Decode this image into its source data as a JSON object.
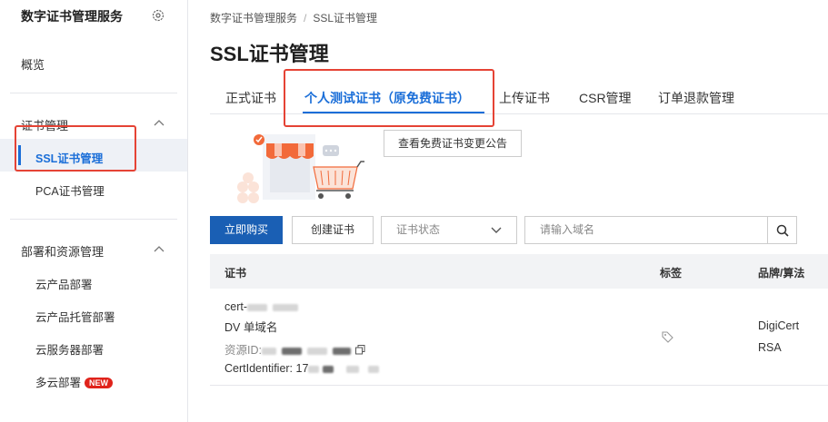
{
  "sidebar": {
    "title": "数字证书管理服务",
    "overview": "概览",
    "group1": {
      "label": "证书管理",
      "items": [
        "SSL证书管理",
        "PCA证书管理"
      ]
    },
    "group2": {
      "label": "部署和资源管理",
      "items": [
        "云产品部署",
        "云产品托管部署",
        "云服务器部署",
        "多云部署"
      ]
    },
    "new_badge": "NEW"
  },
  "breadcrumb": {
    "root": "数字证书管理服务",
    "sep": "/",
    "current": "SSL证书管理"
  },
  "page_title": "SSL证书管理",
  "tabs": [
    "正式证书",
    "个人测试证书（原免费证书）",
    "上传证书",
    "CSR管理",
    "订单退款管理"
  ],
  "notice_button": "查看免费证书变更公告",
  "toolbar": {
    "buy": "立即购买",
    "create": "创建证书",
    "status_placeholder": "证书状态",
    "search_placeholder": "请输入域名"
  },
  "table": {
    "headers": [
      "证书",
      "标签",
      "品牌/算法"
    ],
    "row": {
      "cert_prefix": "cert-",
      "type": "DV 单域名",
      "resource_prefix": "资源ID:",
      "identifier_prefix": "CertIdentifier: 17",
      "brand": "DigiCert",
      "algorithm": "RSA"
    }
  },
  "colors": {
    "accent": "#1a6ed8",
    "primary_button": "#1a5fb4",
    "highlight_box": "#e54335"
  }
}
